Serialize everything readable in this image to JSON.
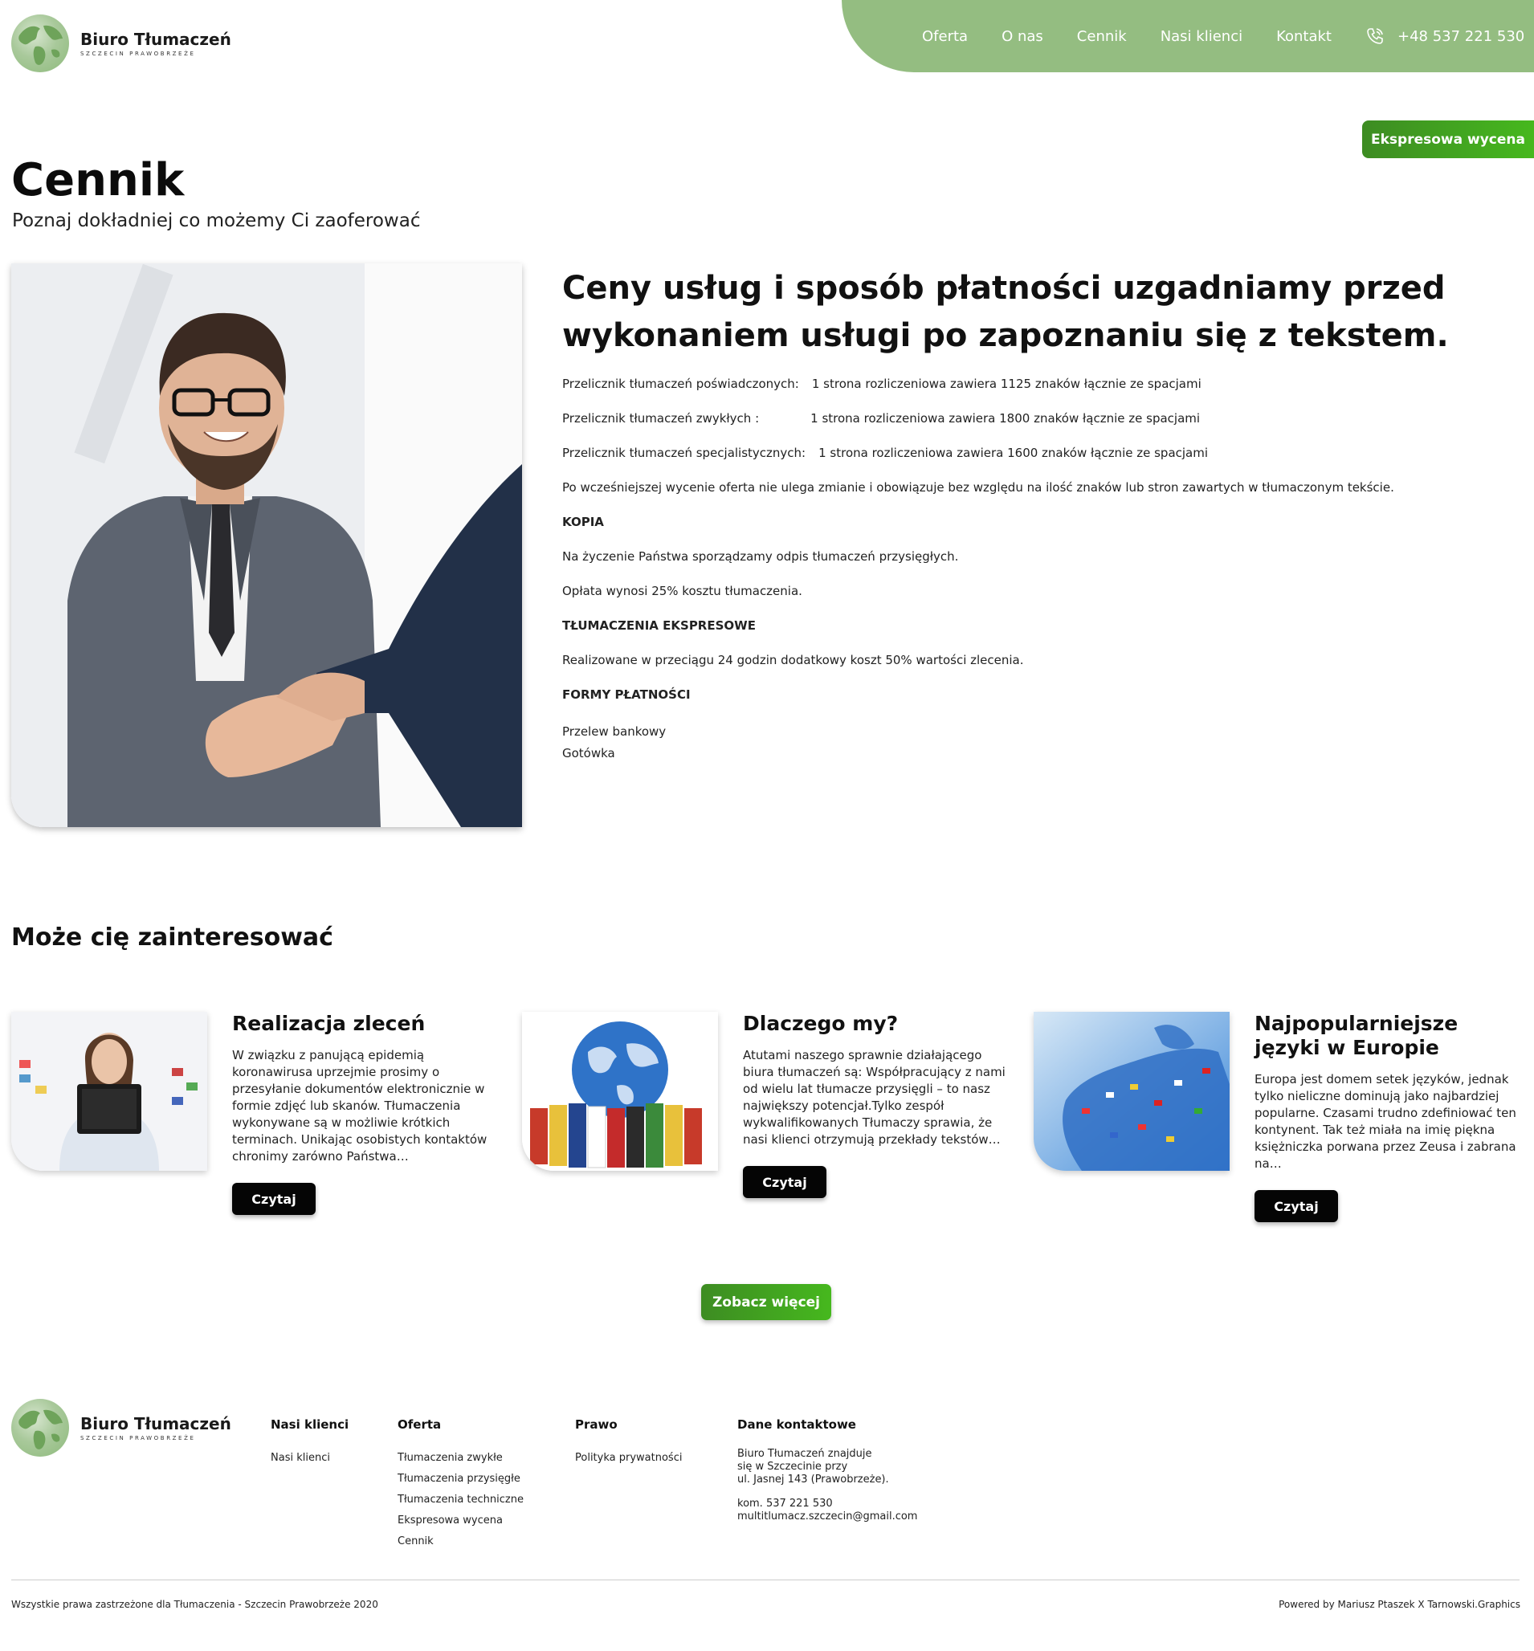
{
  "brand": {
    "title": "Biuro Tłumaczeń",
    "subtitle": "SZCZECIN PRAWOBRZEŻE"
  },
  "nav": {
    "items": [
      "Oferta",
      "O nas",
      "Cennik",
      "Nasi klienci",
      "Kontakt"
    ],
    "phone": "+48 537 221 530",
    "phone_icon": "phone-icon"
  },
  "express_button": "Ekspresowa wycena",
  "page": {
    "title": "Cennik",
    "subtitle": "Poznaj dokładniej co możemy Ci zaoferować"
  },
  "pricing": {
    "heading": "Ceny usług i sposób płatności uzgadniamy przed wykonaniem usługi po zapoznaniu się z tekstem.",
    "rows": [
      {
        "label": "Przelicznik tłumaczeń poświadczonych:",
        "value": "1 strona rozliczeniowa zawiera 1125 znaków łącznie ze spacjami"
      },
      {
        "label": "Przelicznik tłumaczeń zwykłych :",
        "value": "1 strona rozliczeniowa zawiera 1800 znaków łącznie ze spacjami"
      },
      {
        "label": "Przelicznik tłumaczeń specjalistycznych:",
        "value": "1 strona rozliczeniowa zawiera 1600 znaków łącznie ze spacjami"
      }
    ],
    "note": "Po wcześniejszej wycenie oferta nie ulega zmianie i obowiązuje bez względu na ilość znaków lub stron zawartych w tłumaczonym tekście.",
    "copy_heading": "KOPIA",
    "copy_text1": "Na życzenie Państwa sporządzamy odpis tłumaczeń przysięgłych.",
    "copy_text2": "Opłata wynosi 25% kosztu tłumaczenia.",
    "express_heading": "TŁUMACZENIA EKSPRESOWE",
    "express_text": "Realizowane w przeciągu 24 godzin dodatkowy koszt 50% wartości zlecenia.",
    "payment_heading": "FORMY PŁATNOŚCI",
    "payment_methods": [
      "Przelew bankowy",
      "Gotówka"
    ]
  },
  "related": {
    "title": "Może cię zainteresować",
    "read_label": "Czytaj",
    "cards": [
      {
        "title": "Realizacja zleceń",
        "text": "W związku z panującą epidemią koronawirusa uprzejmie prosimy  o przesyłanie dokumentów elektronicznie w formie zdjęć lub skanów. Tłumaczenia wykonywane są w możliwie krótkich terminach. Unikając osobistych kontaktów chronimy zarówno Państwa…"
      },
      {
        "title": "Dlaczego my?",
        "text": "Atutami naszego sprawnie działającego biura tłumaczeń są: Współpracujący z nami od wielu lat tłumacze przysięgli – to nasz największy potencjał.Tylko zespół wykwalifikowanych Tłumaczy sprawia, że nasi klienci otrzymują przekłady tekstów…"
      },
      {
        "title": "Najpopularniejsze języki w Europie",
        "text": "Europa jest domem setek języków, jednak tylko nieliczne dominują jako najbardziej popularne. Czasami trudno zdefiniować  ten kontynent. Tak też miała na imię piękna księżniczka porwana przez Zeusa  i zabrana na…"
      }
    ],
    "more_label": "Zobacz więcej"
  },
  "footer": {
    "clients": {
      "title": "Nasi klienci",
      "items": [
        "Nasi klienci"
      ]
    },
    "offer": {
      "title": "Oferta",
      "items": [
        "Tłumaczenia zwykłe",
        "Tłumaczenia przysięgłe",
        "Tłumaczenia techniczne",
        "Ekspresowa wycena",
        "Cennik"
      ]
    },
    "law": {
      "title": "Prawo",
      "items": [
        "Polityka prywatności"
      ]
    },
    "contact": {
      "title": "Dane kontaktowe",
      "line1": "Biuro Tłumaczeń znajduje",
      "line2": "się w Szczecinie przy",
      "line3": "ul. Jasnej 143 (Prawobrzeże).",
      "phone": "kom. 537 221 530",
      "email": "multitlumacz.szczecin@gmail.com"
    },
    "copyright": "Wszystkie prawa zastrzeżone dla Tłumaczenia - Szczecin Prawobrzeże 2020",
    "powered": "Powered by Mariusz Ptaszek X Tarnowski.Graphics"
  },
  "colors": {
    "nav_green": "#94bd81",
    "button_green": "#3d8c22",
    "dark_button": "#050505"
  }
}
